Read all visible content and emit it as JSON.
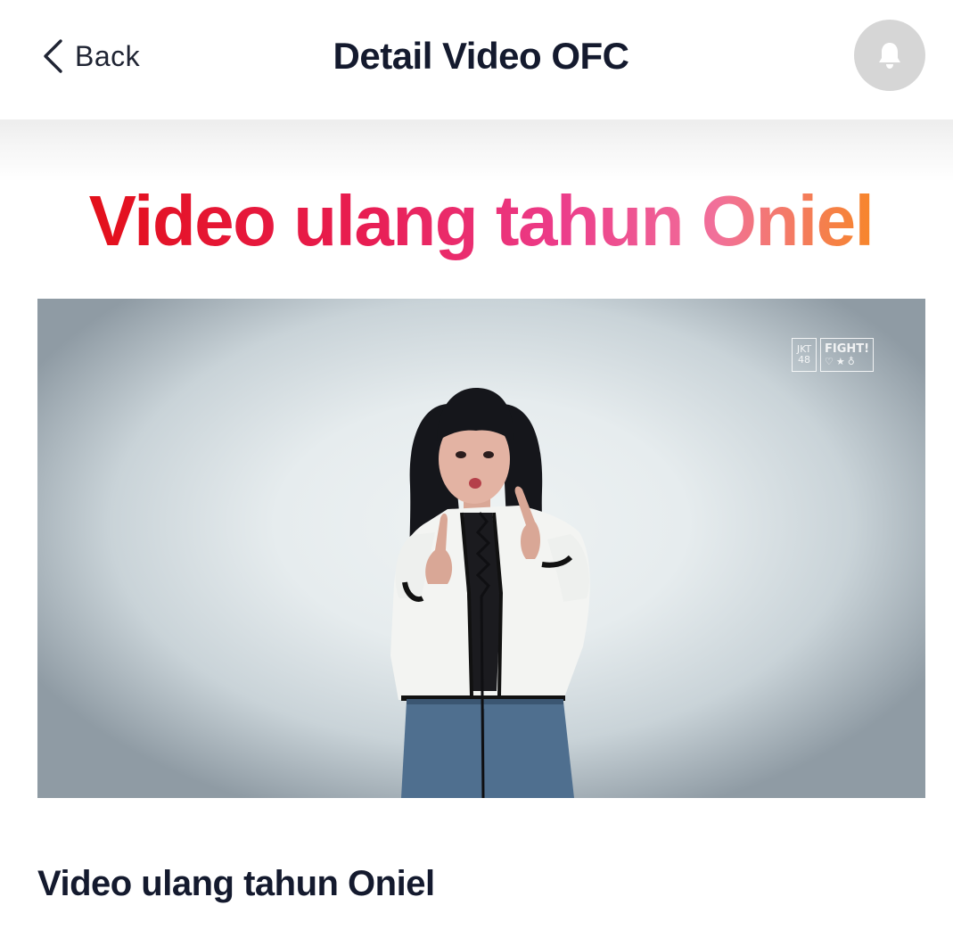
{
  "header": {
    "back_label": "Back",
    "title": "Detail Video OFC",
    "back_icon": "chevron-left-icon",
    "notification_icon": "bell-icon"
  },
  "hero": {
    "title": "Video ulang tahun Oniel",
    "gradient_colors": [
      "#e3101a",
      "#ec3c8a",
      "#f7862a"
    ]
  },
  "video": {
    "watermark": {
      "brand_line1": "JKT",
      "brand_line2": "48",
      "badge_text": "FIGHT!",
      "badge_icons": "♡★♁"
    }
  },
  "details": {
    "title": "Video ulang tahun Oniel"
  },
  "colors": {
    "text_dark": "#141a2e",
    "notification_bg": "#d6d6d6"
  }
}
